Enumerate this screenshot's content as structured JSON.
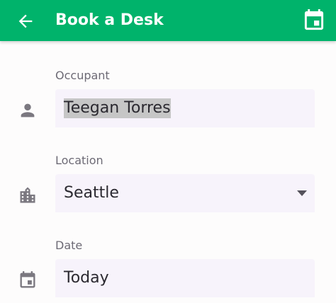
{
  "appbar": {
    "title": "Book a Desk",
    "back_icon": "arrow-left-icon",
    "action_icon": "calendar-icon",
    "color": "#00b36b"
  },
  "form": {
    "occupant": {
      "label": "Occupant",
      "value": "Teegan Torres",
      "icon": "person-icon"
    },
    "location": {
      "label": "Location",
      "value": "Seattle",
      "icon": "city-icon"
    },
    "date": {
      "label": "Date",
      "value": "Today",
      "icon": "calendar-icon"
    }
  }
}
